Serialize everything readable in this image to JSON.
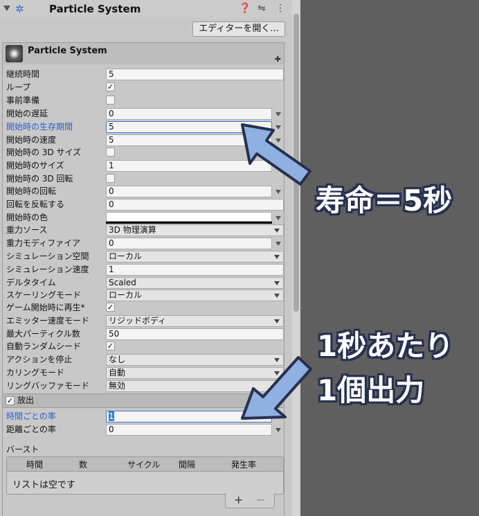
{
  "header": {
    "title": "Particle System"
  },
  "editor_button": "エディターを開く...",
  "module": {
    "title": "Particle System"
  },
  "rows": [
    {
      "label": "継続時間",
      "value": "5"
    },
    {
      "label": "ループ",
      "value": "✓"
    },
    {
      "label": "事前準備",
      "value": ""
    },
    {
      "label": "開始の遅延",
      "value": "0"
    },
    {
      "label": "開始時の生存期間",
      "value": "5"
    },
    {
      "label": "開始時の速度",
      "value": "5"
    },
    {
      "label": "開始時の 3D サイズ",
      "value": ""
    },
    {
      "label": "開始時のサイズ",
      "value": "1"
    },
    {
      "label": "開始時の 3D 回転",
      "value": ""
    },
    {
      "label": "開始時の回転",
      "value": "0"
    },
    {
      "label": "回転を反転する",
      "value": "0"
    },
    {
      "label": "開始時の色",
      "value": ""
    },
    {
      "label": "重力ソース",
      "value": "3D 物理演算"
    },
    {
      "label": "重力モディファイア",
      "value": "0"
    },
    {
      "label": "シミュレーション空間",
      "value": "ローカル"
    },
    {
      "label": "シミュレーション速度",
      "value": "1"
    },
    {
      "label": "デルタタイム",
      "value": "Scaled"
    },
    {
      "label": "スケーリングモード",
      "value": "ローカル"
    },
    {
      "label": "ゲーム開始時に再生*",
      "value": "✓"
    },
    {
      "label": "エミッター速度モード",
      "value": "リジッドボディ"
    },
    {
      "label": "最大パーティクル数",
      "value": "50"
    },
    {
      "label": "自動ランダムシード",
      "value": "✓"
    },
    {
      "label": "アクションを停止",
      "value": "なし"
    },
    {
      "label": "カリングモード",
      "value": "自動"
    },
    {
      "label": "リングバッファモード",
      "value": "無効"
    }
  ],
  "emission": {
    "title": "放出",
    "checked": "✓",
    "rate_over_time_label": "時間ごとの率",
    "rate_over_time_value": "1",
    "rate_over_distance_label": "距離ごとの率",
    "rate_over_distance_value": "0",
    "bursts_label": "バースト",
    "burst_columns": [
      "時間",
      "数",
      "サイクル",
      "間隔",
      "発生率"
    ],
    "empty_text": "リストは空です",
    "add": "+",
    "remove": "−"
  },
  "annotations": {
    "lifetime": "寿命＝5秒",
    "rate_line1": "1秒あたり",
    "rate_line2": "1個出力"
  },
  "colors": {
    "highlight": "#2a5fc9",
    "arrow_fill": "#8fb0e0",
    "arrow_stroke": "#26304f"
  }
}
